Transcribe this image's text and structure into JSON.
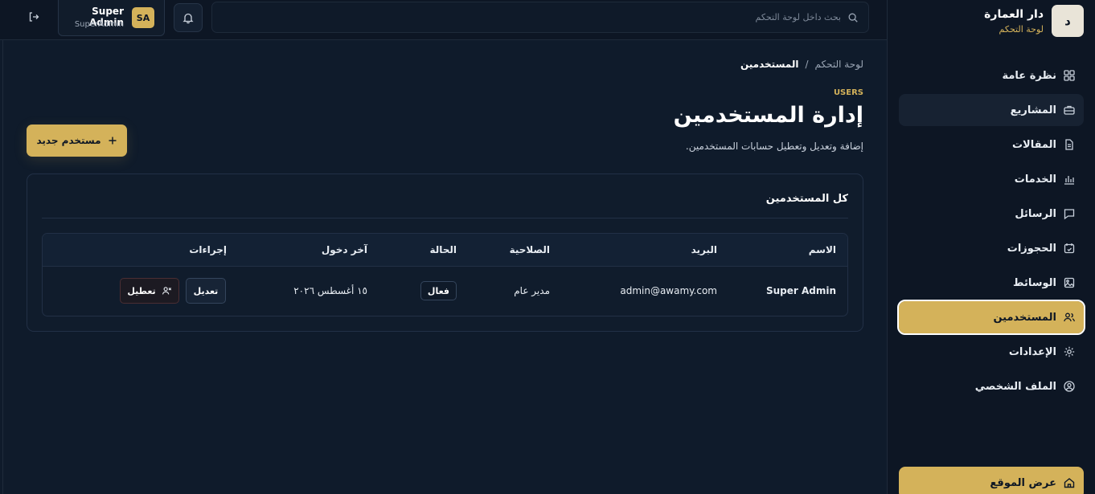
{
  "brand": {
    "logo_letter": "د",
    "name": "دار العمارة",
    "subtitle": "لوحة التحكم"
  },
  "sidebar": {
    "items": [
      {
        "label": "نظرة عامة",
        "icon": "grid-icon"
      },
      {
        "label": "المشاريع",
        "icon": "briefcase-icon"
      },
      {
        "label": "المقالات",
        "icon": "document-icon"
      },
      {
        "label": "الخدمات",
        "icon": "bar-chart-icon"
      },
      {
        "label": "الرسائل",
        "icon": "message-icon"
      },
      {
        "label": "الحجوزات",
        "icon": "calendar-check-icon"
      },
      {
        "label": "الوسائط",
        "icon": "image-icon"
      },
      {
        "label": "المستخدمين",
        "icon": "users-icon",
        "active": true
      },
      {
        "label": "الإعدادات",
        "icon": "gear-icon"
      },
      {
        "label": "الملف الشخصي",
        "icon": "user-circle-icon"
      }
    ],
    "view_site": "عرض الموقع"
  },
  "topbar": {
    "search_placeholder": "بحث داخل لوحة التحكم",
    "user": {
      "initials": "SA",
      "name": "Super Admin",
      "role": "SuperAdmin"
    }
  },
  "page": {
    "breadcrumb": {
      "root": "لوحة التحكم",
      "separator": "/",
      "current": "المستخدمين"
    },
    "eyebrow": "USERS",
    "title": "إدارة المستخدمين",
    "subtitle": "إضافة وتعديل وتعطيل حسابات المستخدمين.",
    "new_user_button": "مستخدم جديد"
  },
  "users_card": {
    "title": "كل المستخدمين",
    "columns": [
      "الاسم",
      "البريد",
      "الصلاحية",
      "الحالة",
      "آخر دخول",
      "إجراءات"
    ],
    "rows": [
      {
        "name": "Super Admin",
        "email": "admin@awamy.com",
        "role": "مدير عام",
        "status": "فعال",
        "last_login": "١٥ أغسطس ٢٠٢٦",
        "edit_label": "تعديل",
        "disable_label": "تعطيل"
      }
    ]
  },
  "colors": {
    "accent": "#d4b25a",
    "background": "#0f1b2b",
    "sidebar": "#0d1624"
  }
}
